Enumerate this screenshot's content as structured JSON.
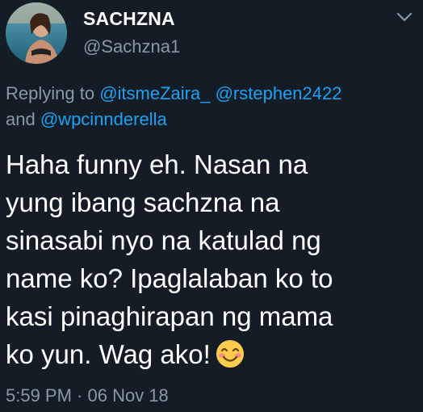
{
  "tweet": {
    "author": {
      "display_name": "SACHZNA",
      "handle": "@Sachzna1"
    },
    "reply": {
      "prefix": "Replying to",
      "mentions": [
        "@itsmeZaira_",
        "@rstephen2422",
        "@wpcinnderella"
      ],
      "conjunction": "and"
    },
    "text_lines": [
      "Haha funny eh. Nasan na",
      "yung ibang sachzna na",
      "sinasabi nyo na katulad ng",
      "name ko? Ipaglalaban ko to",
      "kasi pinaghirapan ng mama",
      "ko yun. Wag ako!"
    ],
    "emoji": "smiling-face-with-smiling-eyes",
    "timestamp": "5:59 PM · 06 Nov 18"
  },
  "colors": {
    "background": "#141d26",
    "text": "#ffffff",
    "secondary": "#8899a6",
    "link": "#1da1f2"
  },
  "icons": {
    "menu_caret": "chevron-down-icon"
  }
}
